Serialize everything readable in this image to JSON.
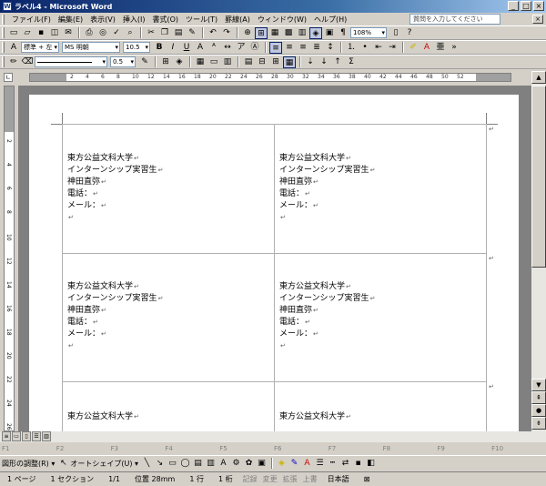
{
  "window": {
    "title": "ラベル4 - Microsoft Word",
    "icon_letter": "W",
    "minimize": "_",
    "maximize": "□",
    "close": "×"
  },
  "menu": {
    "items": [
      "ファイル(F)",
      "編集(E)",
      "表示(V)",
      "挿入(I)",
      "書式(O)",
      "ツール(T)",
      "罫線(A)",
      "ウィンドウ(W)",
      "ヘルプ(H)"
    ],
    "help_placeholder": "質問を入力してください",
    "doc_close": "×"
  },
  "toolbar_standard": {
    "zoom": "108%"
  },
  "toolbar_format": {
    "style": "標準 + 左",
    "font": "MS 明朝",
    "size": "10.5",
    "bold": "B",
    "italic": "I",
    "underline": "U"
  },
  "toolbar_tables": {
    "line_weight": "0.5"
  },
  "ruler": {
    "h_ticks": [
      "2",
      "4",
      "6",
      "8",
      "10",
      "12",
      "14",
      "16",
      "18",
      "20",
      "22",
      "24",
      "26",
      "28",
      "30",
      "32",
      "34",
      "36",
      "38",
      "40",
      "42",
      "44",
      "46",
      "48",
      "50",
      "52"
    ],
    "v_ticks": [
      "2",
      "4",
      "6",
      "8",
      "10",
      "12",
      "14",
      "16",
      "18",
      "20",
      "22",
      "24",
      "26"
    ]
  },
  "labels": [
    {
      "lines": [
        "東方公益文科大学",
        "インターンシップ実習生",
        "神田直弥",
        "電話：",
        "メール：",
        ""
      ]
    },
    {
      "lines": [
        "東方公益文科大学",
        "インターンシップ実習生",
        "神田直弥",
        "電話：",
        "メール：",
        ""
      ]
    },
    {
      "lines": [
        "東方公益文科大学",
        "インターンシップ実習生",
        "神田直弥",
        "電話：",
        "メール：",
        ""
      ]
    },
    {
      "lines": [
        "東方公益文科大学",
        "インターンシップ実習生",
        "神田直弥",
        "電話：",
        "メール：",
        ""
      ]
    },
    {
      "lines": [
        "東方公益文科大学"
      ]
    },
    {
      "lines": [
        "東方公益文科大学"
      ]
    }
  ],
  "para_mark": "↵",
  "fkeys": [
    "F1",
    "F2",
    "F3",
    "F4",
    "F5",
    "F6",
    "F7",
    "F8",
    "F9",
    "F10"
  ],
  "drawbar": {
    "draw_label": "図形の調整(R) ▾",
    "autoshape_label": "オートシェイプ(U) ▾"
  },
  "status": {
    "page": "1 ページ",
    "section": "1 セクション",
    "page_of": "1/1",
    "position": "位置 28mm",
    "line": "1 行",
    "column": "1 桁",
    "rec": "記録",
    "trk": "変更",
    "ext": "拡張",
    "ovr": "上書",
    "language": "日本語"
  }
}
